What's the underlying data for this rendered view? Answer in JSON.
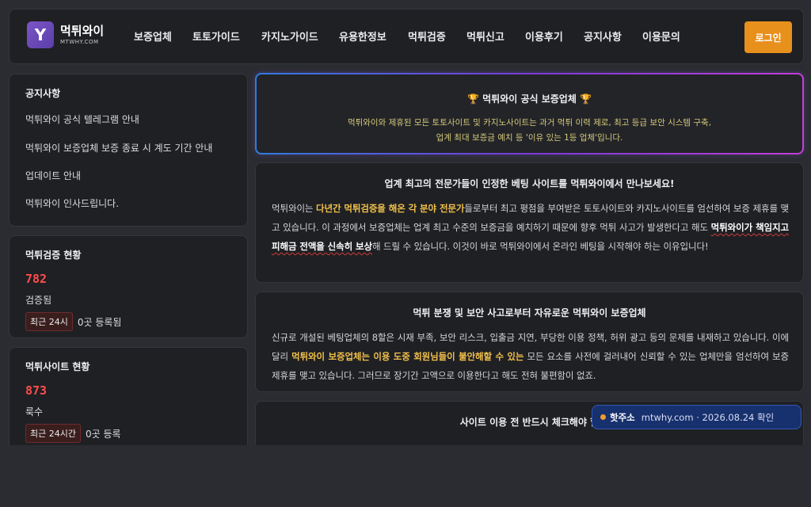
{
  "header": {
    "logo_letter": "Y",
    "logo_name": "먹튀와이",
    "logo_domain": "MTWHY.COM",
    "nav": [
      "보증업체",
      "토토가이드",
      "카지노가이드",
      "유용한정보",
      "먹튀검증",
      "먹튀신고",
      "이용후기",
      "공지사항",
      "이용문의"
    ],
    "login_label": "로그인"
  },
  "sidebar": {
    "notices": {
      "title": "공지사항",
      "items": [
        "먹튀와이 공식 텔레그램 안내",
        "먹튀와이 보증업체 보증 종료 시 계도 기간 안내",
        "업데이트 안내",
        "먹튀와이 인사드립니다."
      ]
    },
    "verify_stats": {
      "title": "먹튀검증 현황",
      "count": "782",
      "count_label": "검증됨",
      "pill": "최근 24시",
      "pill_after": "0곳 등록됨"
    },
    "site_stats": {
      "title": "먹튀사이트 현황",
      "count": "873",
      "count_label": "룩수",
      "pill": "최근 24시간",
      "pill_after": "0곳 등록"
    }
  },
  "hero": {
    "title": "🏆 먹튀와이 공식 보증업체 🏆",
    "line1": "먹튀와이와 제휴된 모든 토토사이트 및 카지노사이트는 과거 먹튀 이력 제로, 최고 등급 보안 시스템 구축,",
    "line2": "업계 최대 보증금 예치 등 '이유 있는 1등 업체'입니다."
  },
  "article1": {
    "title": "업계 최고의 전문가들이 인정한 베팅 사이트를 먹튀와이에서 만나보세요!",
    "p_a": "먹튀와이는 ",
    "p_hl": "다년간 먹튀검증을 해온 각 분야 전문가",
    "p_b": "들로부터 최고 평점을 부여받은 토토사이트와 카지노사이트를 엄선하여 보증 제휴를 맺고 있습니다. 이 과정에서 보증업체는 업계 최고 수준의 보증금을 예치하기 때문에 향후 먹튀 사고가 발생한다고 해도 ",
    "p_ul": "먹튀와이가 책임지고 피해금 전액을 신속히 보상",
    "p_c": "해 드릴 수 있습니다. 이것이 바로 먹튀와이에서 온라인 베팅을 시작해야 하는 이유입니다!"
  },
  "article2": {
    "title": "먹튀 분쟁 및 보안 사고로부터 자유로운 먹튀와이 보증업체",
    "p_a": "신규로 개설된 베팅업체의 8할은 시재 부족, 보안 리스크, 입출금 지연, 부당한 이용 정책, 허위 광고 등의 문제를 내재하고 있습니다. 이에 달리 ",
    "p_hl": "먹튀와이 보증업체는 이용 도중 회원님들이 불안해할 수 있는",
    "p_b": " 모든 요소를 사전에 걸러내어 신뢰할 수 있는 업체만을 엄선하여 보증 제휴를 맺고 있습니다. 그러므로 장기간 고액으로 이용한다고 해도 전혀 불편함이 없죠."
  },
  "article3": {
    "title": "사이트 이용 전 반드시 체크해야 할"
  },
  "toast": {
    "label": "핫주소",
    "text": "mtwhy.com · 2026.08.24 확인"
  },
  "colors": {
    "accent_orange": "#e8901c",
    "highlight_yellow": "#f0c04a",
    "stat_red": "#ff4d4d",
    "toast_blue": "#17306e"
  }
}
